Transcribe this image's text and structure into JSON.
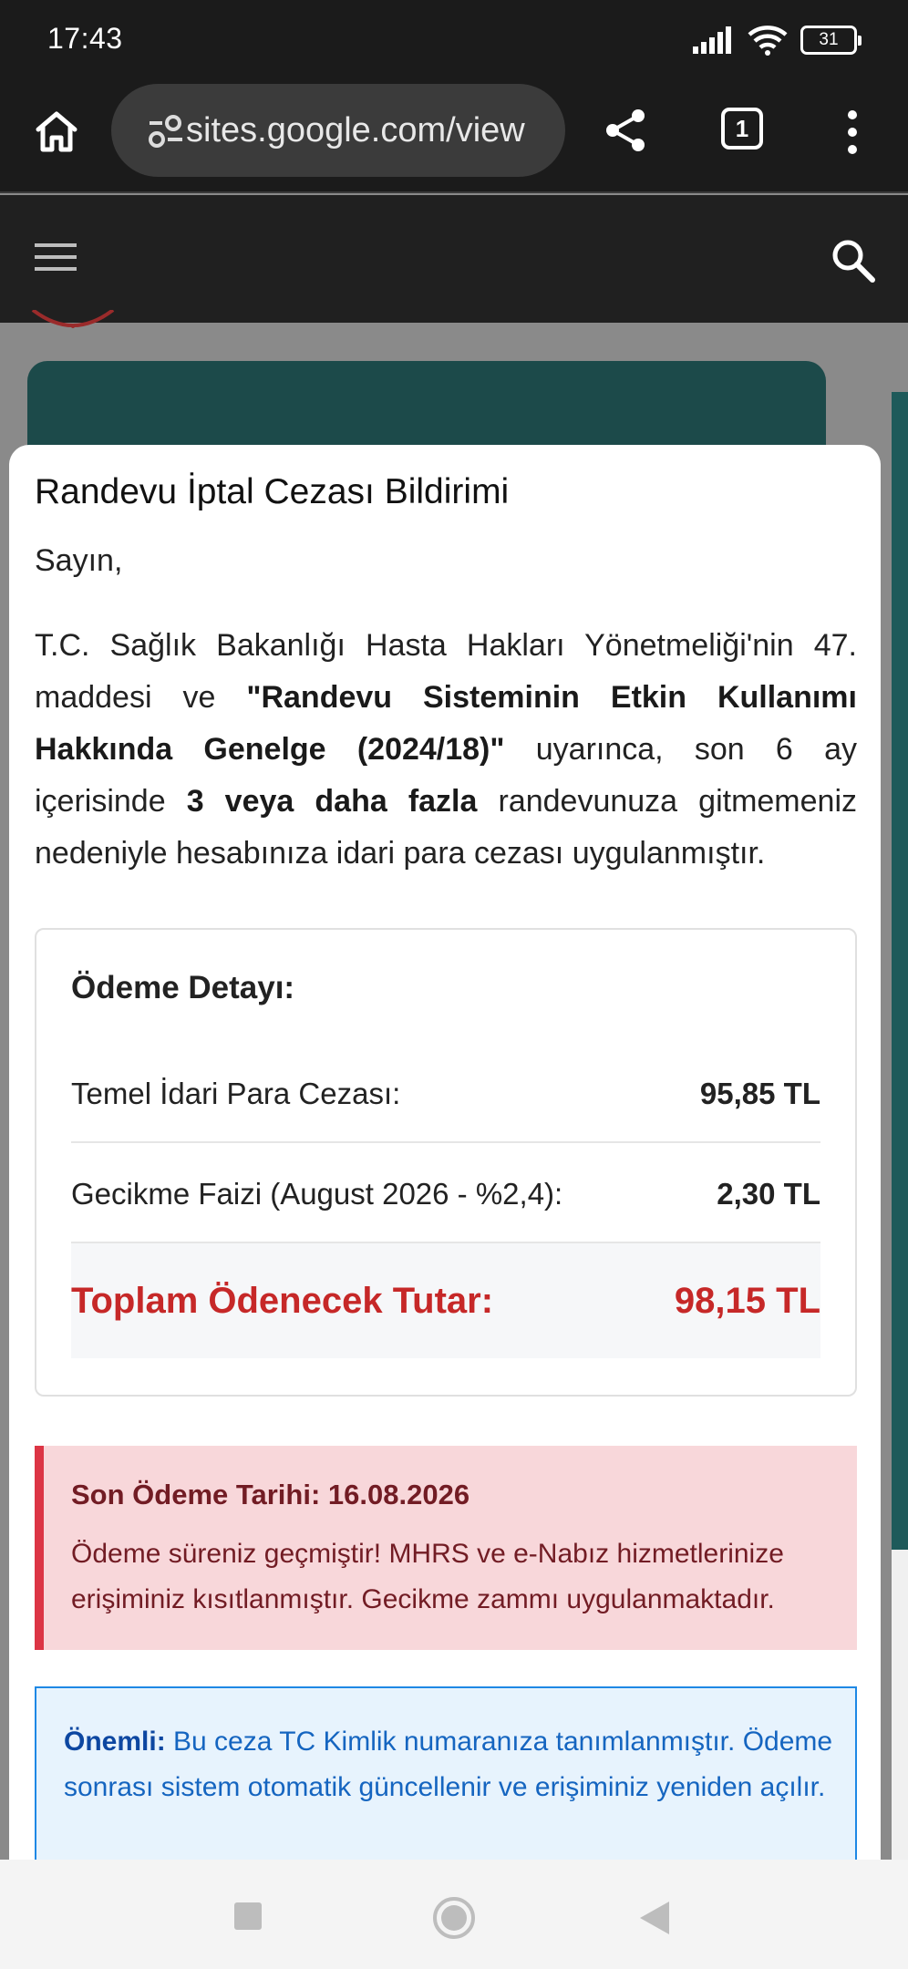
{
  "status_bar": {
    "time": "17:43",
    "battery": "31",
    "icons": [
      "signal-icon",
      "wifi-icon",
      "battery-icon"
    ]
  },
  "browser": {
    "url": "sites.google.com/view",
    "tab_count": "1",
    "icons": [
      "home-icon",
      "site-settings-icon",
      "share-icon",
      "tabs-icon",
      "more-vert-icon"
    ]
  },
  "site_header": {
    "icons": [
      "hamburger-menu-icon",
      "search-icon"
    ]
  },
  "modal": {
    "title": "Randevu İptal Cezası Bildirimi",
    "greeting": "Sayın,",
    "paragraph": {
      "part1": "T.C. Sağlık Bakanlığı Hasta Hakları Yönetmeliği'nin 47. maddesi ve ",
      "bold1": "\"Randevu Sisteminin Etkin Kullanımı Hakkında Genelge (2024/18)\"",
      "part2": " uyarınca, son 6 ay içerisinde ",
      "bold2": "3 veya daha fazla",
      "part3": " randevunuza gitmemeniz nedeniyle hesabınıza idari para cezası uygulanmıştır."
    },
    "payment": {
      "title": "Ödeme Detayı:",
      "rows": [
        {
          "label": "Temel İdari Para Cezası:",
          "value": "95,85 TL"
        },
        {
          "label": "Gecikme Faizi (August 2026 - %2,4):",
          "value": "2,30 TL"
        }
      ],
      "total_label": "Toplam Ödenecek Tutar:",
      "total_value": "98,15 TL"
    },
    "warning": {
      "title": "Son Ödeme Tarihi: 16.08.2026",
      "text": "Ödeme süreniz geçmiştir! MHRS ve e-Nabız hizmetlerinize erişiminiz kısıtlanmıştır. Gecikme zammı uygulanmaktadır."
    },
    "info": {
      "bold": "Önemli:",
      "text": " Bu ceza TC Kimlik numaranıza tanımlanmıştır. Ödeme sonrası sistem otomatik güncellenir ve erişiminiz yeniden açılır."
    }
  },
  "colors": {
    "total_red": "#c62828",
    "warning_bg": "#f8d7da",
    "warning_text": "#721c24",
    "info_border": "#1e88e5",
    "info_text": "#1565c0",
    "teal_card": "#1c4a4a"
  },
  "nav_bar": {
    "icons": [
      "recents-square-icon",
      "home-circle-icon",
      "back-triangle-icon"
    ]
  }
}
